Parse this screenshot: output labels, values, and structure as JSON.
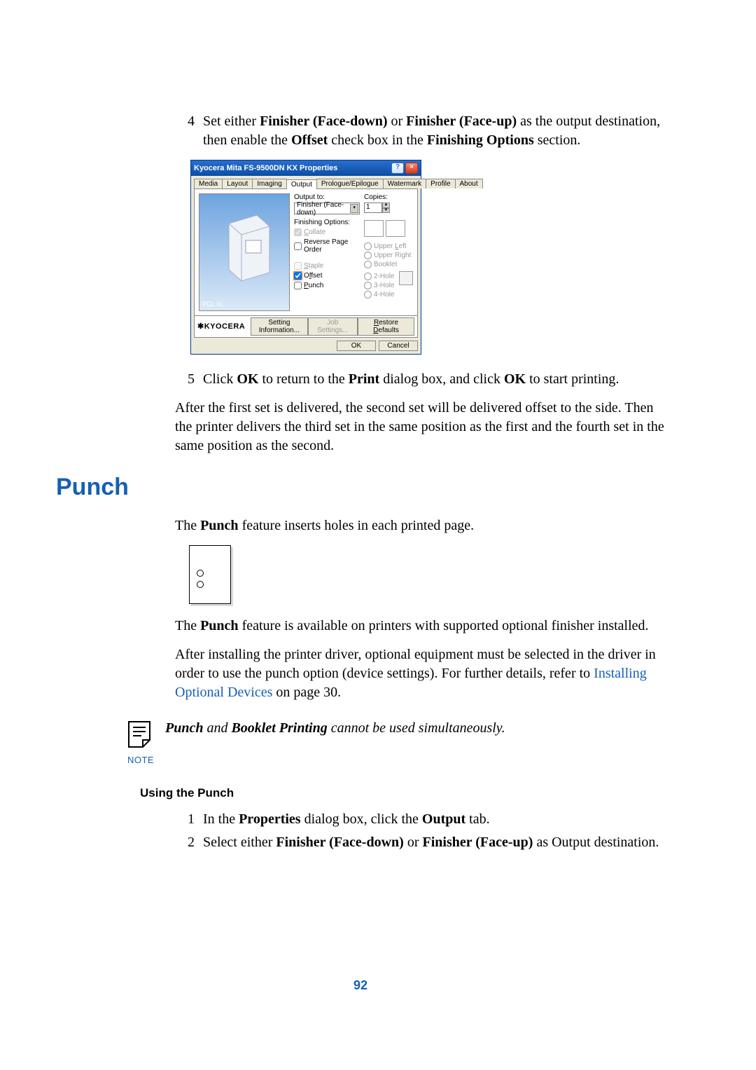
{
  "step4": {
    "num": "4",
    "pre": "Set either ",
    "b1": "Finisher (Face-down)",
    "mid1": " or ",
    "b2": "Finisher (Face-up)",
    "mid2": " as the output destination, then enable the ",
    "b3": "Offset",
    "mid3": " check box in the ",
    "b4": "Finishing Options",
    "end": " section."
  },
  "dialog": {
    "title": "Kyocera Mita FS-9500DN KX Properties",
    "tabs": [
      "Media",
      "Layout",
      "Imaging",
      "Output",
      "Prologue/Epilogue",
      "Watermark",
      "Profile",
      "About"
    ],
    "active_tab": "Output",
    "output_to_label": "Output to:",
    "output_to_value": "Finisher (Face-down)",
    "copies_label": "Copies:",
    "copies_value": "1",
    "finishing_label": "Finishing Options:",
    "collate": "Collate",
    "reverse": "Reverse Page Order",
    "staple": "Staple",
    "offset": "Offset",
    "punch": "Punch",
    "pos": {
      "ul": "Upper Left",
      "ur": "Upper Right",
      "bk": "Booklet",
      "h2": "2-Hole",
      "h3": "3-Hole",
      "h4": "4-Hole"
    },
    "preview_label": "PCL XL",
    "brand": "KYOCERA",
    "setting_info": "Setting Information...",
    "job_settings": "Job Settings...",
    "restore": "Restore Defaults",
    "ok": "OK",
    "cancel": "Cancel"
  },
  "step5": {
    "num": "5",
    "pre": "Click ",
    "b1": "OK",
    "mid1": " to return to the ",
    "b2": "Print",
    "mid2": " dialog box, and click ",
    "b3": "OK",
    "end": " to start printing."
  },
  "offset_para": "After the first set is delivered, the second set will be delivered offset to the side. Then the printer delivers the third set in the same position as the first and the fourth set in the same position as the second.",
  "punch_heading": "Punch",
  "punch_intro_pre": "The ",
  "punch_intro_b": "Punch",
  "punch_intro_end": " feature inserts holes in each printed page.",
  "punch_supported_pre": "The ",
  "punch_supported_b": "Punch",
  "punch_supported_end": " feature is available on printers with supported optional finisher installed.",
  "punch_install_line": "After installing the printer driver, optional equipment must be selected in the driver in order to use the punch option (device settings). For further details, refer to ",
  "punch_install_link": "Installing Optional Devices",
  "punch_install_tail": " on page 30.",
  "note_label": "NOTE",
  "note_b1": "Punch",
  "note_mid": " and ",
  "note_b2": "Booklet Printing",
  "note_end": " cannot be used simultaneously.",
  "using_punch": "Using the Punch",
  "up1": {
    "num": "1",
    "pre": "In the ",
    "b1": "Properties",
    "mid": " dialog box, click the ",
    "b2": "Output",
    "end": " tab."
  },
  "up2": {
    "num": "2",
    "pre": "Select either ",
    "b1": "Finisher (Face-down)",
    "mid": " or ",
    "b2": "Finisher (Face-up)",
    "end": " as Output destination."
  },
  "page_number": "92"
}
